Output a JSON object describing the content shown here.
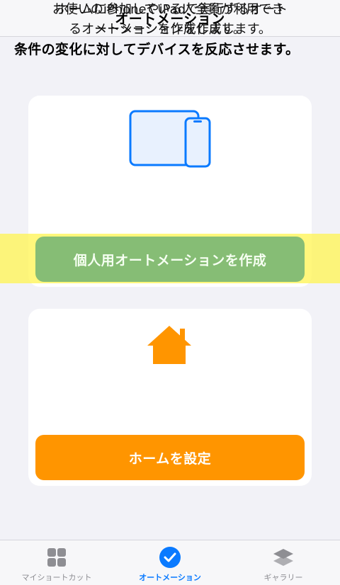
{
  "header": {
    "title": "オートメーション"
  },
  "subtitle": "条件の変化に対してデバイスを反応させます。",
  "personal_card": {
    "icon": "iphone-ipad-icon",
    "description_line1": "お使いのiPhoneやiPadで実行するオート",
    "description_line2": "メーションを作成します。",
    "button_label": "個人用オートメーションを作成",
    "button_color": "#86bd75"
  },
  "home_card": {
    "icon": "home-icon",
    "description_line1": "ホームに参加している人全員が利用でき",
    "description_line2": "るオートメーションを作成します。",
    "button_label": "ホームを設定",
    "button_color": "#ff9500"
  },
  "tabs": [
    {
      "label": "マイショートカット",
      "icon": "grid-icon",
      "active": false
    },
    {
      "label": "オートメーション",
      "icon": "checkmark-circle-icon",
      "active": true
    },
    {
      "label": "ギャラリー",
      "icon": "layers-icon",
      "active": false
    }
  ],
  "colors": {
    "accent": "#0a7aff",
    "highlight": "#fff450",
    "background": "#f2f2f7"
  }
}
